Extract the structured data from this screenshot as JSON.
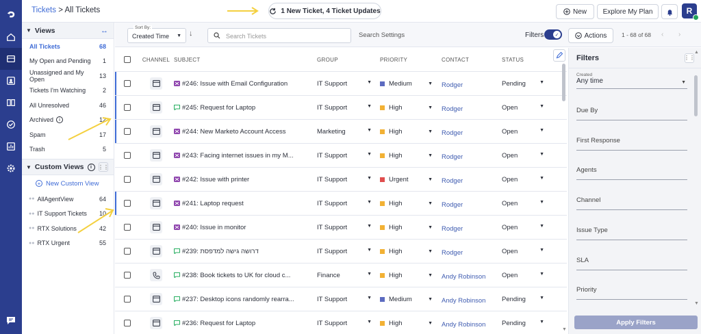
{
  "breadcrumb": {
    "root": "Tickets",
    "separator": ">",
    "current": "All Tickets"
  },
  "header": {
    "update_button": "1 New Ticket, 4 Ticket Updates",
    "new_button": "New",
    "plan_button": "Explore My Plan",
    "avatar_letter": "R"
  },
  "views": {
    "title": "Views",
    "items": [
      {
        "label": "All Tickets",
        "count": "68"
      },
      {
        "label": "My Open and Pending",
        "count": "1"
      },
      {
        "label": "Unassigned and My Open",
        "count": "13"
      },
      {
        "label": "Tickets I'm Watching",
        "count": "2"
      },
      {
        "label": "All Unresolved",
        "count": "46"
      },
      {
        "label": "Archived",
        "count": "12"
      },
      {
        "label": "Spam",
        "count": "17"
      },
      {
        "label": "Trash",
        "count": "5"
      }
    ]
  },
  "custom_views": {
    "title": "Custom Views",
    "new_label": "New Custom View",
    "items": [
      {
        "label": "AllAgentView",
        "count": "64"
      },
      {
        "label": "IT Support Tickets",
        "count": "10"
      },
      {
        "label": "RTX Solutions",
        "count": "42"
      },
      {
        "label": "RTX Urgent",
        "count": "55"
      }
    ]
  },
  "toolbar": {
    "sort_label": "Sort By:",
    "sort_value": "Created Time",
    "search_placeholder": "Search Tickets",
    "search_settings": "Search Settings",
    "filters_label": "Filters",
    "actions_label": "Actions",
    "pager": "1 - 68 of 68"
  },
  "table": {
    "columns": [
      "CHANNEL",
      "SUBJECT",
      "GROUP",
      "PRIORITY",
      "CONTACT",
      "STATUS"
    ],
    "rows": [
      {
        "channel": "web",
        "type": "incident",
        "subject": "#246: Issue with Email Configuration",
        "group": "IT Support",
        "priority": "Medium",
        "priority_color": "#5c6bc0",
        "contact": "Rodger",
        "status": "Pending",
        "unread": true
      },
      {
        "channel": "web",
        "type": "request",
        "subject": "#245: Request for Laptop",
        "group": "IT Support",
        "priority": "High",
        "priority_color": "#f2b134",
        "contact": "Rodger",
        "status": "Open",
        "unread": true
      },
      {
        "channel": "web",
        "type": "incident",
        "subject": "#244: New Marketo Account Access",
        "group": "Marketing",
        "priority": "High",
        "priority_color": "#f2b134",
        "contact": "Rodger",
        "status": "Open",
        "unread": true
      },
      {
        "channel": "web",
        "type": "incident",
        "subject": "#243: Facing internet issues in my M...",
        "group": "IT Support",
        "priority": "High",
        "priority_color": "#f2b134",
        "contact": "Rodger",
        "status": "Open",
        "unread": false
      },
      {
        "channel": "web",
        "type": "incident",
        "subject": "#242: Issue with printer",
        "group": "IT Support",
        "priority": "Urgent",
        "priority_color": "#e04e4e",
        "contact": "Rodger",
        "status": "Open",
        "unread": false
      },
      {
        "channel": "web",
        "type": "incident",
        "subject": "#241: Laptop request",
        "group": "IT Support",
        "priority": "High",
        "priority_color": "#f2b134",
        "contact": "Rodger",
        "status": "Open",
        "unread": true
      },
      {
        "channel": "web",
        "type": "incident",
        "subject": "#240: Issue in monitor",
        "group": "IT Support",
        "priority": "High",
        "priority_color": "#f2b134",
        "contact": "Rodger",
        "status": "Open",
        "unread": false
      },
      {
        "channel": "web",
        "type": "request",
        "subject": "#239: דרושה גישה למדפסת",
        "group": "IT Support",
        "priority": "High",
        "priority_color": "#f2b134",
        "contact": "Rodger",
        "status": "Open",
        "unread": false
      },
      {
        "channel": "phone",
        "type": "request",
        "subject": "#238: Book tickets to UK for cloud c...",
        "group": "Finance",
        "priority": "High",
        "priority_color": "#f2b134",
        "contact": "Andy Robinson",
        "status": "Open",
        "unread": false
      },
      {
        "channel": "web",
        "type": "request",
        "subject": "#237: Desktop icons randomly rearra...",
        "group": "IT Support",
        "priority": "Medium",
        "priority_color": "#5c6bc0",
        "contact": "Andy Robinson",
        "status": "Pending",
        "unread": false
      },
      {
        "channel": "web",
        "type": "request",
        "subject": "#236: Request for Laptop",
        "group": "IT Support",
        "priority": "High",
        "priority_color": "#f2b134",
        "contact": "Andy Robinson",
        "status": "Pending",
        "unread": false
      }
    ]
  },
  "filters": {
    "title": "Filters",
    "created_label": "Created",
    "created_value": "Any time",
    "fields": [
      "Due By",
      "First Response",
      "Agents",
      "Channel",
      "Issue Type",
      "SLA",
      "Priority"
    ],
    "apply_button": "Apply Filters"
  },
  "colors": {
    "rail": "#2b3e8e",
    "accent": "#3e6bd6",
    "annotation": "#f4d03f"
  }
}
